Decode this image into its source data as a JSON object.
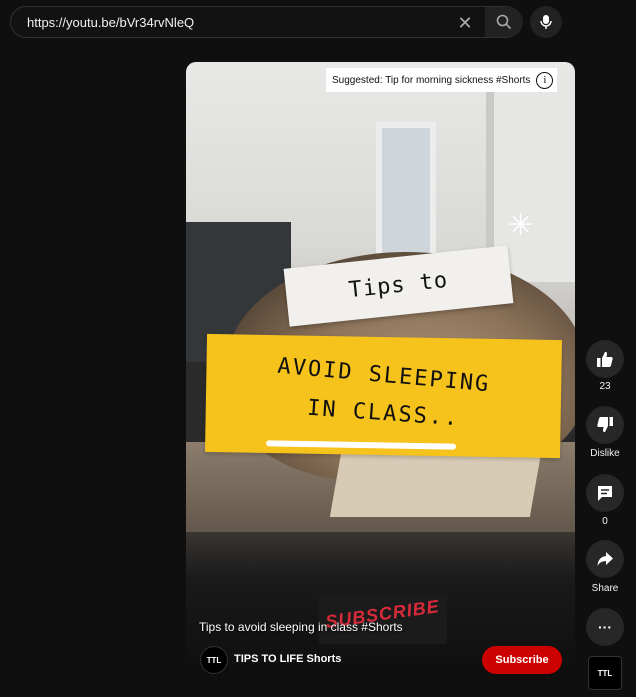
{
  "search": {
    "url": "https://youtu.be/bVr34rvNleQ",
    "clear_glyph": "✕"
  },
  "video": {
    "suggested": "Suggested: Tip for morning sickness #Shorts",
    "overlay_line1": "Tips to",
    "overlay_line2": "AVOID SLEEPING",
    "overlay_line3": "IN CLASS..",
    "subscribe_sticker": "SUBSCRIBE",
    "title": "Tips to avoid sleeping in class #Shorts",
    "channel_avatar": "TTL",
    "channel_name": "TIPS TO LIFE Shorts",
    "subscribe_label": "Subscribe"
  },
  "actions": {
    "like_count": "23",
    "dislike_label": "Dislike",
    "comment_count": "0",
    "share_label": "Share",
    "more_glyph": "···",
    "channel_thumb": "TTL"
  },
  "icons": {
    "search": "search-icon",
    "mic": "mic-icon",
    "clear": "close-icon",
    "info": "info-icon",
    "like": "thumbs-up-icon",
    "dislike": "thumbs-down-icon",
    "comment": "comment-icon",
    "share": "share-icon",
    "more": "more-icon"
  },
  "colors": {
    "background": "#0f0f0f",
    "subscribe": "#cc0000",
    "note_yellow": "#f6c21c",
    "action_button": "#272727"
  }
}
